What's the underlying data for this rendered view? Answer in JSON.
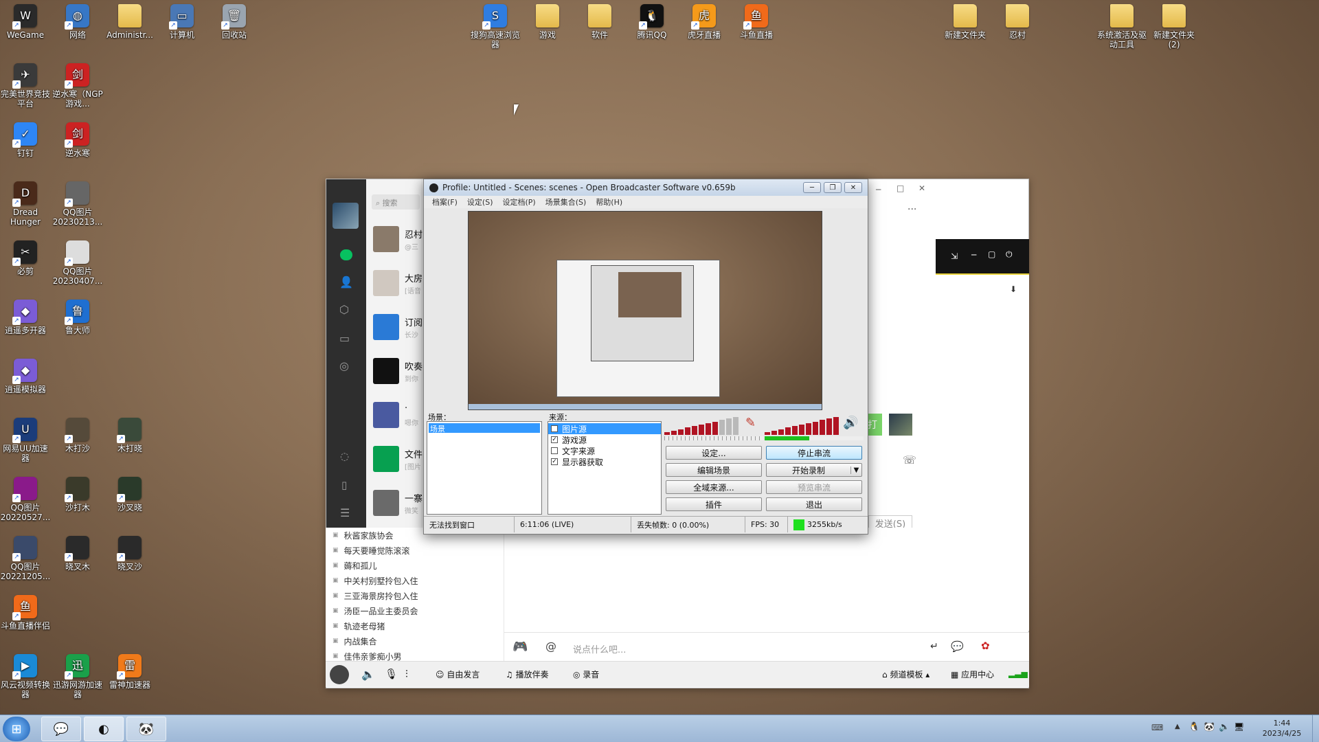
{
  "desktop": {
    "icons_left": [
      {
        "label": "WeGame",
        "color": "#2a2a2a",
        "glyph": "W"
      },
      {
        "label": "网络",
        "color": "#3777c6",
        "glyph": "◍"
      },
      {
        "label": "Administr...",
        "color": "folder",
        "glyph": ""
      },
      {
        "label": "计算机",
        "color": "#4a78b5",
        "glyph": "▭"
      },
      {
        "label": "回收站",
        "color": "#9aa5b0",
        "glyph": "🗑"
      },
      {
        "label": "完美世界竞技平台",
        "color": "#3a3a3a",
        "glyph": "✈"
      },
      {
        "label": "逆水寒（NGP游戏...",
        "color": "#c22",
        "glyph": "剑"
      },
      {
        "label": "钉钉",
        "color": "#2e86f5",
        "glyph": "✓"
      },
      {
        "label": "逆水寒",
        "color": "#c22",
        "glyph": "剑"
      },
      {
        "label": "Dread Hunger",
        "color": "#4a2a1a",
        "glyph": "D"
      },
      {
        "label": "QQ图片20230213...",
        "color": "#666",
        "glyph": ""
      },
      {
        "label": "必剪",
        "color": "#222",
        "glyph": "✂"
      },
      {
        "label": "QQ图片20230407...",
        "color": "#ddd",
        "glyph": ""
      },
      {
        "label": "逍遥多开器",
        "color": "#7b5cd6",
        "glyph": "◆"
      },
      {
        "label": "鲁大师",
        "color": "#1f6fd1",
        "glyph": "鲁"
      },
      {
        "label": "逍遥模拟器",
        "color": "#7b5cd6",
        "glyph": "◆"
      },
      {
        "label": "网易UU加速器",
        "color": "#1b3c7a",
        "glyph": "U"
      },
      {
        "label": "木打沙",
        "color": "#554a3a",
        "glyph": ""
      },
      {
        "label": "木打晓",
        "color": "#3a4a3a",
        "glyph": ""
      },
      {
        "label": "QQ图片20220527...",
        "color": "#8a1a8a",
        "glyph": ""
      },
      {
        "label": "沙打木",
        "color": "#3a3a2a",
        "glyph": ""
      },
      {
        "label": "沙叉晓",
        "color": "#2a3a2a",
        "glyph": ""
      },
      {
        "label": "QQ图片20221205...",
        "color": "#3a4a6a",
        "glyph": ""
      },
      {
        "label": "晓叉木",
        "color": "#2a2a2a",
        "glyph": ""
      },
      {
        "label": "晓叉沙",
        "color": "#2a2a2a",
        "glyph": ""
      },
      {
        "label": "斗鱼直播伴侣",
        "color": "#f06a1a",
        "glyph": "鱼"
      },
      {
        "label": "风云视频转换器",
        "color": "#1a8ad6",
        "glyph": "▶"
      },
      {
        "label": "迅游网游加速器",
        "color": "#1aa04a",
        "glyph": "迅"
      },
      {
        "label": "雷神加速器",
        "color": "#f07a1a",
        "glyph": "雷"
      }
    ],
    "icons_top": [
      {
        "label": "搜狗高速浏览器",
        "color": "#2f7de1",
        "glyph": "S"
      },
      {
        "label": "游戏",
        "color": "folder",
        "glyph": ""
      },
      {
        "label": "软件",
        "color": "folder",
        "glyph": ""
      },
      {
        "label": "腾讯QQ",
        "color": "#111",
        "glyph": "🐧"
      },
      {
        "label": "虎牙直播",
        "color": "#f59a1a",
        "glyph": "虎"
      },
      {
        "label": "斗鱼直播",
        "color": "#f06a1a",
        "glyph": "鱼"
      }
    ],
    "icons_right": [
      {
        "label": "新建文件夹",
        "color": "folder",
        "glyph": ""
      },
      {
        "label": "忍村",
        "color": "folder",
        "glyph": ""
      },
      {
        "label": "系统激活及驱动工具",
        "color": "folder",
        "glyph": ""
      },
      {
        "label": "新建文件夹(2)",
        "color": "folder",
        "glyph": ""
      }
    ]
  },
  "chat_app": {
    "search_placeholder": "搜索",
    "conversations": [
      {
        "name": "忍村",
        "preview": "@三"
      },
      {
        "name": "大房",
        "preview": "[语音"
      },
      {
        "name": "订阅",
        "preview": "长沙"
      },
      {
        "name": "吹奏",
        "preview": "到你"
      },
      {
        "name": "·",
        "preview": "嗯你"
      },
      {
        "name": "文件",
        "preview": "[图片"
      },
      {
        "name": "一寨",
        "preview": "微笑"
      }
    ],
    "more_icon_label": "···"
  },
  "voice_app": {
    "channels": [
      "秋酱家族协会",
      "每天要睡觉陈滚滚",
      "薅和孤儿",
      "中关村别墅拎包入住",
      "三亚海景房拎包入住",
      "汤臣一品业主委员会",
      "轨迹老母猪",
      "内战集合",
      "佳伟亲爹痴小男"
    ],
    "input_placeholder": "说点什么吧...",
    "send_label": "发送(S)",
    "partial_button": "打",
    "bottom_tools": [
      "自由发言",
      "播放伴奏",
      "录音"
    ],
    "bottom_right": [
      "频道模板",
      "应用中心"
    ]
  },
  "obs": {
    "title": "Profile: Untitled - Scenes: scenes - Open Broadcaster Software v0.659b",
    "menu": [
      "档案(F)",
      "设定(S)",
      "设定档(P)",
      "场景集合(S)",
      "帮助(H)"
    ],
    "scenes_label": "场景：",
    "sources_label": "来源：",
    "scenes": [
      "场景"
    ],
    "sources": [
      {
        "name": "图片源",
        "checked": false,
        "selected": true
      },
      {
        "name": "游戏源",
        "checked": true,
        "selected": false
      },
      {
        "name": "文字来源",
        "checked": false,
        "selected": false
      },
      {
        "name": "显示器获取",
        "checked": true,
        "selected": false
      }
    ],
    "buttons": {
      "settings": "设定...",
      "stop_stream": "停止串流",
      "edit_scene": "编辑场景",
      "start_record": "开始录制",
      "global_sources": "全域来源...",
      "preview_stream": "预览串流",
      "plugins": "插件",
      "exit": "退出"
    },
    "status": {
      "message": "无法找到窗口",
      "time": "6:11:06 (LIVE)",
      "dropped": "丢失帧数: 0 (0.00%)",
      "fps": "FPS: 30",
      "bitrate": "3255kb/s",
      "bitrate_color": "#1ee01e"
    }
  },
  "taskbar": {
    "clock_time": "1:44",
    "clock_date": "2023/4/25"
  }
}
